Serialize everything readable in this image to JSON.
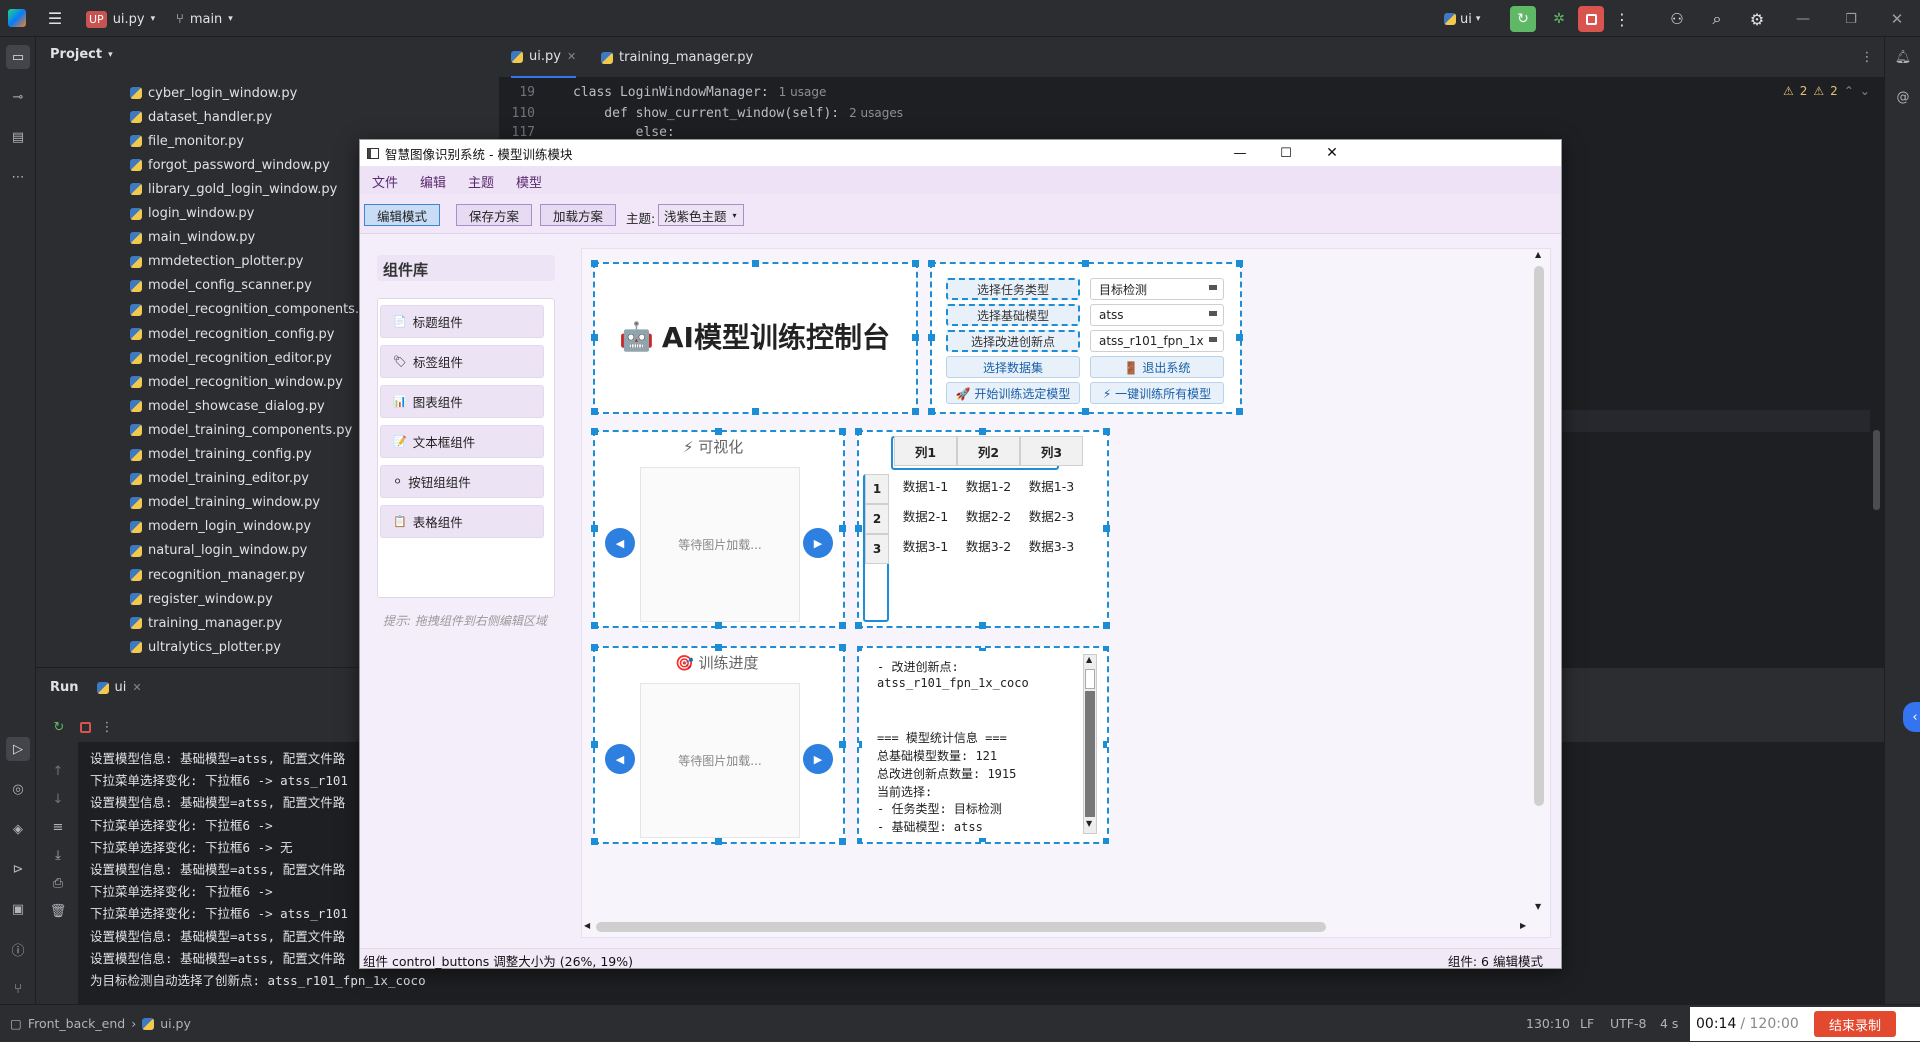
{
  "ide": {
    "project_badge": "UP",
    "file_name": "ui.py",
    "branch": "main",
    "run_config": "ui",
    "project_panel_title": "Project",
    "files": [
      "cyber_login_window.py",
      "dataset_handler.py",
      "file_monitor.py",
      "forgot_password_window.py",
      "library_gold_login_window.py",
      "login_window.py",
      "main_window.py",
      "mmdetection_plotter.py",
      "model_config_scanner.py",
      "model_recognition_components.py",
      "model_recognition_config.py",
      "model_recognition_editor.py",
      "model_recognition_window.py",
      "model_showcase_dialog.py",
      "model_training_components.py",
      "model_training_config.py",
      "model_training_editor.py",
      "model_training_window.py",
      "modern_login_window.py",
      "natural_login_window.py",
      "recognition_manager.py",
      "register_window.py",
      "training_manager.py",
      "ultralytics_plotter.py"
    ],
    "editor_tabs": [
      "ui.py",
      "training_manager.py"
    ],
    "code_lines": [
      {
        "num": "19",
        "code": "class LoginWindowManager:",
        "hint": "1 usage"
      },
      {
        "num": "110",
        "code": "    def show_current_window(self):",
        "hint": "2 usages"
      },
      {
        "num": "117",
        "code": "        else:",
        "hint": ""
      }
    ],
    "inspection": {
      "warnings": "2",
      "weak_warnings": "2"
    },
    "run_tab_label": "Run",
    "run_tab_config": "ui",
    "console_lines": [
      "设置模型信息: 基础模型=atss, 配置文件路",
      "下拉菜单选择变化: 下拉框6 -> atss_r101",
      "设置模型信息: 基础模型=atss, 配置文件路",
      "下拉菜单选择变化: 下拉框6 ->",
      "下拉菜单选择变化: 下拉框6 -> 无",
      "设置模型信息: 基础模型=atss, 配置文件路",
      "下拉菜单选择变化: 下拉框6 ->",
      "下拉菜单选择变化: 下拉框6 -> atss_r101",
      "设置模型信息: 基础模型=atss, 配置文件路",
      "设置模型信息: 基础模型=atss, 配置文件路",
      "为目标检测自动选择了创新点: atss_r101_fpn_1x_coco"
    ],
    "status": {
      "breadcrumb_project": "Front_back_end",
      "breadcrumb_file": "ui.py",
      "position": "130:10",
      "line_sep": "LF",
      "encoding": "UTF-8",
      "indent": "4 s"
    },
    "recorder": {
      "time": "00:14",
      "total": "/ 120:00",
      "stop_label": "结束录制"
    },
    "colors": {
      "bg": "#1e1f22",
      "panel": "#2b2d30",
      "green": "#5fb865",
      "red": "#d9534f"
    }
  },
  "app": {
    "title": "智慧图像识别系统 - 模型训练模块",
    "menus": [
      "文件",
      "编辑",
      "主题",
      "模型"
    ],
    "toolbar": {
      "edit_mode": "编辑模式",
      "save_plan": "保存方案",
      "load_plan": "加载方案",
      "theme_label": "主题:",
      "theme_value": "浅紫色主题"
    },
    "palette": {
      "title": "组件库",
      "items": [
        {
          "icon": "📄",
          "label": "标题组件"
        },
        {
          "icon": "🏷",
          "label": "标签组件"
        },
        {
          "icon": "📊",
          "label": "图表组件"
        },
        {
          "icon": "📝",
          "label": "文本框组件"
        },
        {
          "icon": "⚪",
          "label": "按钮组组件"
        },
        {
          "icon": "📋",
          "label": "表格组件"
        }
      ],
      "hint": "提示: 拖拽组件到右侧编辑区域"
    },
    "title_component": {
      "icon": "🤖",
      "text": "AI模型训练控制台"
    },
    "controls": {
      "left_buttons": [
        "选择任务类型",
        "选择基础模型",
        "选择改进创新点",
        "选择数据集",
        "🚀 开始训练选定模型"
      ],
      "combos": [
        "目标检测",
        "atss",
        "atss_r101_fpn_1x"
      ],
      "exit": "🚪 退出系统",
      "train_all": "⚡ 一键训练所有模型"
    },
    "visual": {
      "title": "⚡ 可视化",
      "placeholder": "等待图片加载..."
    },
    "table": {
      "headers": [
        "列1",
        "列2",
        "列3"
      ],
      "row_headers": [
        "1",
        "2",
        "3"
      ],
      "rows": [
        [
          "数据1-1",
          "数据1-2",
          "数据1-3"
        ],
        [
          "数据2-1",
          "数据2-2",
          "数据2-3"
        ],
        [
          "数据3-1",
          "数据3-2",
          "数据3-3"
        ]
      ]
    },
    "progress": {
      "title": "🎯 训练进度",
      "placeholder": "等待图片加载..."
    },
    "log_lines": [
      "- 改进创新点:",
      "atss_r101_fpn_1x_coco",
      "",
      "",
      "=== 模型统计信息 ===",
      "总基础模型数量: 121",
      "总改进创新点数量: 1915",
      "当前选择:",
      "- 任务类型: 目标检测",
      "- 基础模型: atss"
    ],
    "status_left": "组件 control_buttons 调整大小为 (26%, 19%)",
    "status_right": "组件: 6  编辑模式",
    "colors": {
      "window_bg": "#f4eefb",
      "dashed": "#1d8ed6",
      "nav": "#2d7fe0"
    }
  }
}
